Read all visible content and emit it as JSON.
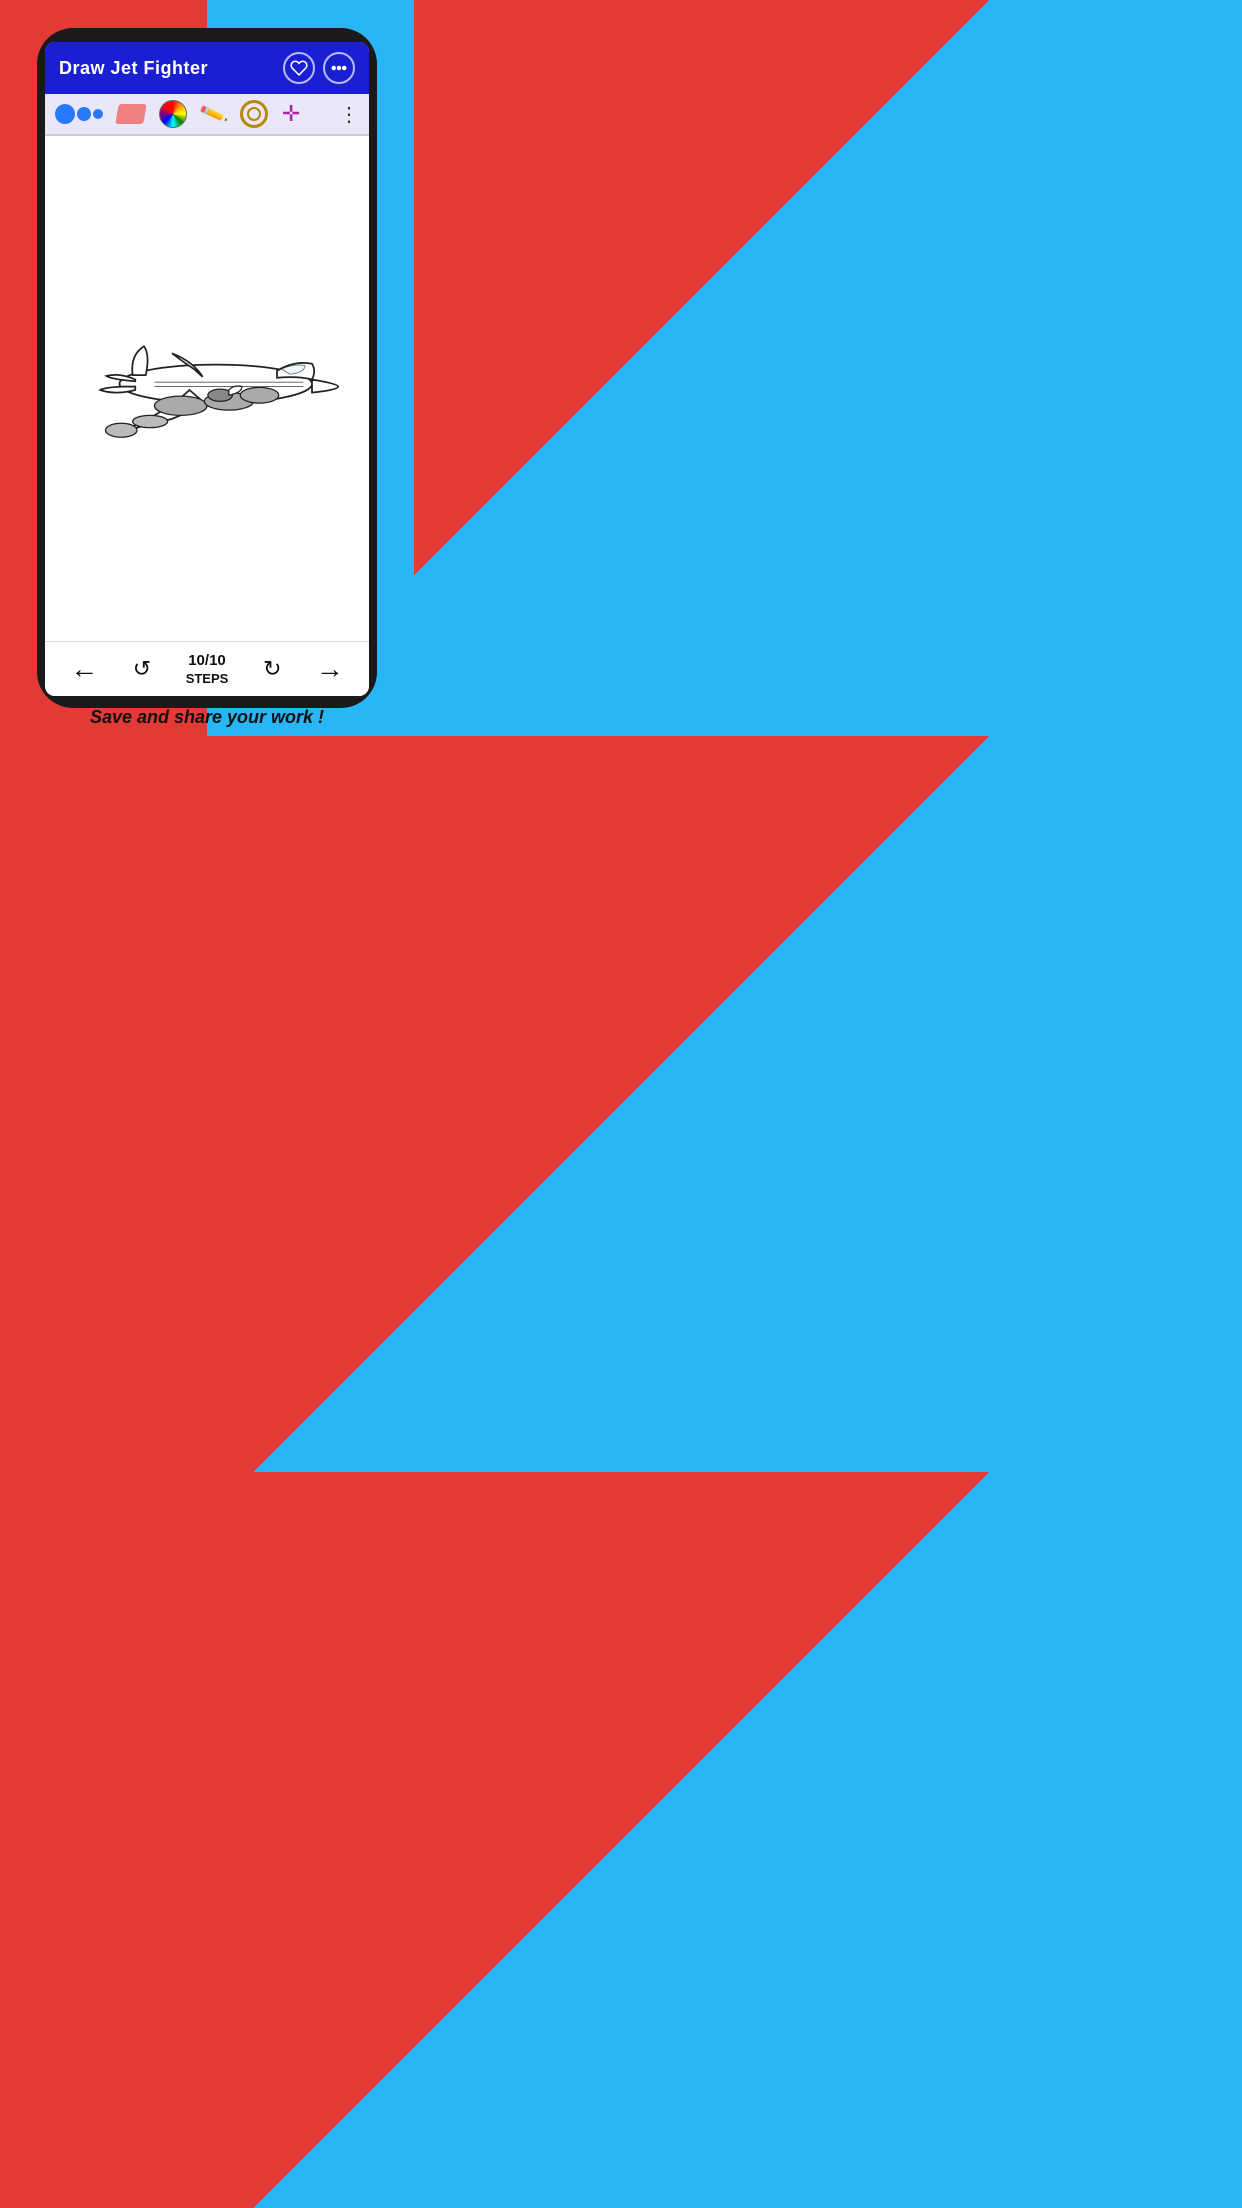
{
  "app": {
    "title": "Draw Jet Fighter",
    "background_left": "#e53935",
    "background_right": "#29b6f6"
  },
  "titlebar": {
    "title": "Draw Jet Fighter",
    "heart_icon": "heart-icon",
    "more_icon": "more-icon",
    "bg_color": "#1a1fd4"
  },
  "toolbar": {
    "brush_tool": "brush-tool",
    "eraser_tool": "eraser-tool",
    "color_wheel_tool": "color-wheel-tool",
    "pencil_tool": "pencil-tool",
    "scan_tool": "scan-tool",
    "move_tool": "move-tool",
    "more_tool": "more-options-tool"
  },
  "step_info": {
    "current": "10",
    "total": "10",
    "display": "10/10",
    "label": "STEPS"
  },
  "bottom_banner": {
    "text": "Save and share your work !"
  },
  "nav": {
    "prev_label": "←",
    "next_label": "→",
    "replay_label": "↺"
  }
}
